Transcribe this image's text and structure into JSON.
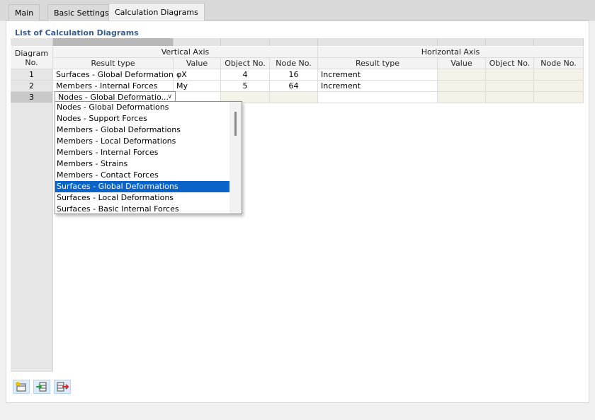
{
  "tabs": [
    {
      "label": "Main"
    },
    {
      "label": "Basic Settings"
    },
    {
      "label": "Calculation Diagrams"
    }
  ],
  "panel": {
    "title": "List of Calculation Diagrams"
  },
  "table": {
    "header": {
      "diagram_no": "Diagram\nNo.",
      "vertical_axis": "Vertical Axis",
      "horizontal_axis": "Horizontal Axis",
      "result_type": "Result type",
      "value": "Value",
      "object_no": "Object No.",
      "node_no": "Node No."
    },
    "rows": [
      {
        "no": "1",
        "v_result_type": "Surfaces - Global Deformations",
        "v_value": "φX",
        "v_object": "4",
        "v_node": "16",
        "h_result_type": "Increment"
      },
      {
        "no": "2",
        "v_result_type": "Members - Internal Forces",
        "v_value": "My",
        "v_object": "5",
        "v_node": "64",
        "h_result_type": "Increment"
      },
      {
        "no": "3",
        "v_result_type": "Nodes - Global Deformatio...",
        "v_value": "",
        "v_object": "",
        "v_node": "",
        "h_result_type": ""
      }
    ]
  },
  "dropdown": {
    "items": [
      "Nodes - Global Deformations",
      "Nodes - Support Forces",
      "Members - Global Deformations",
      "Members - Local Deformations",
      "Members - Internal Forces",
      "Members - Strains",
      "Members - Contact Forces",
      "Surfaces - Global Deformations",
      "Surfaces - Local Deformations",
      "Surfaces - Basic Internal Forces"
    ],
    "selected_index": 7
  },
  "toolbar": {
    "buttons": [
      {
        "icon": "new-row-icon"
      },
      {
        "icon": "import-icon"
      },
      {
        "icon": "export-icon"
      }
    ]
  }
}
